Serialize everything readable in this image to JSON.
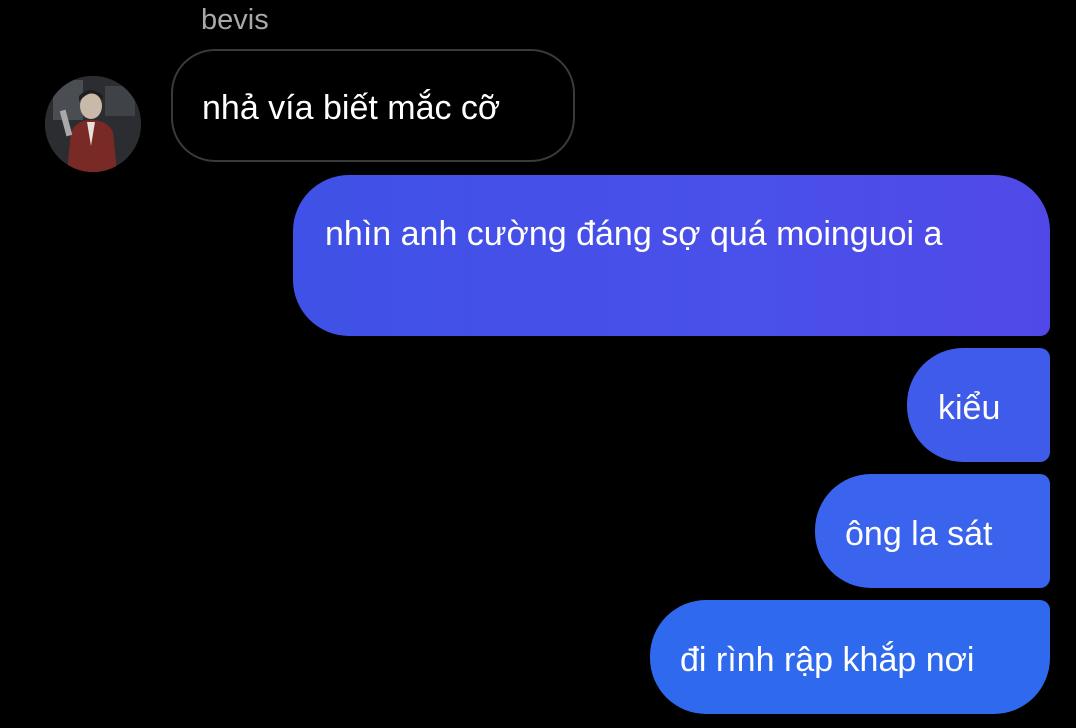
{
  "conversation": {
    "sender_name": "bevis",
    "avatar_icon": "user-avatar-photo",
    "messages": [
      {
        "direction": "received",
        "text": "nhả vía biết mắc cỡ"
      },
      {
        "direction": "sent",
        "text": "nhìn anh cường đáng sợ quá moinguoi a"
      },
      {
        "direction": "sent",
        "text": "kiểu"
      },
      {
        "direction": "sent",
        "text": "ông la sát"
      },
      {
        "direction": "sent",
        "text": "đi rình rập khắp nơi"
      }
    ]
  },
  "colors": {
    "background": "#000000",
    "sender_name": "#a8a8a8",
    "received_border": "#3a3a3a",
    "sent_gradient_top": "#5049e8",
    "sent_gradient_bottom": "#2f6aee",
    "text": "#ffffff"
  }
}
